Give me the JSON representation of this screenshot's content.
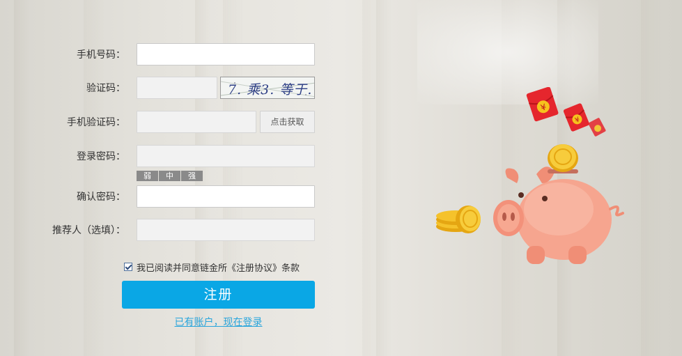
{
  "form": {
    "phone": {
      "label": "手机号码：",
      "value": ""
    },
    "captcha": {
      "label": "验证码：",
      "value": "",
      "image_text": "7. 乘3. 等于. . ."
    },
    "sms_code": {
      "label": "手机验证码：",
      "value": "",
      "button": "点击获取"
    },
    "password": {
      "label": "登录密码：",
      "value": ""
    },
    "strength": {
      "weak": "弱",
      "medium": "中",
      "strong": "强"
    },
    "confirm_password": {
      "label": "确认密码：",
      "value": ""
    },
    "referrer": {
      "label": "推荐人（选填）：",
      "value": ""
    },
    "agreement": {
      "checked": true,
      "text": "我已阅读并同意链金所《注册协议》条款"
    },
    "submit": "注册",
    "login_link": "已有账户，现在登录"
  },
  "illustration": {
    "icon": "piggy-bank-with-coins-and-red-envelopes",
    "envelope_symbol": "¥"
  },
  "colors": {
    "primary_button": "#0aa7e5",
    "link": "#29a5dc",
    "envelope_red": "#e5262d",
    "pig_pink": "#f6a58f",
    "coin_gold": "#f5c22b"
  }
}
